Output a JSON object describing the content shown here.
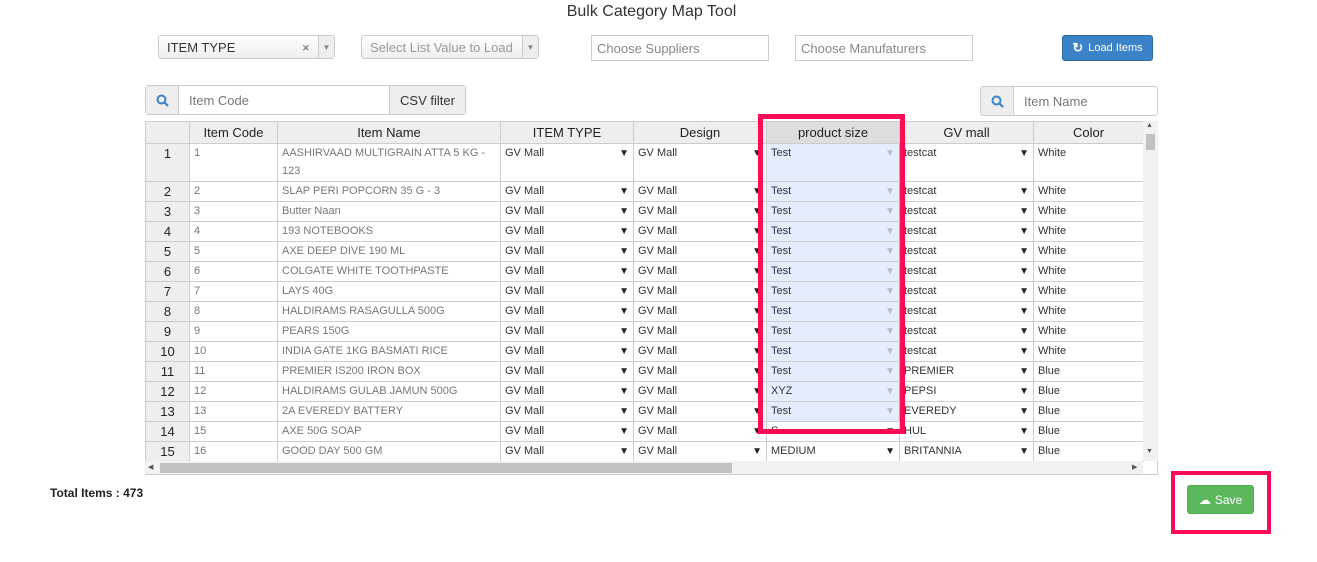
{
  "title": "Bulk Category Map Tool",
  "filters": {
    "item_type_select": "ITEM TYPE",
    "clear": "×",
    "list_value_placeholder": "Select List Value to Load",
    "suppliers_placeholder": "Choose Suppliers",
    "manufacturers_placeholder": "Choose Manufaturers",
    "load_button": "Load Items"
  },
  "search": {
    "item_code_placeholder": "Item Code",
    "csv_filter": "CSV filter",
    "item_name_placeholder": "Item Name"
  },
  "columns": [
    "Item Code",
    "Item Name",
    "ITEM TYPE",
    "Design",
    "product size",
    "GV mall",
    "Color"
  ],
  "rows": [
    {
      "n": "1",
      "code": "1",
      "name": "AASHIRVAAD MULTIGRAIN ATTA 5 KG - 123",
      "type": "GV Mall",
      "design": "GV Mall",
      "size": "Test",
      "mall": "testcat",
      "color": "White"
    },
    {
      "n": "2",
      "code": "2",
      "name": "SLAP PERI POPCORN 35 G - 3",
      "type": "GV Mall",
      "design": "GV Mall",
      "size": "Test",
      "mall": "testcat",
      "color": "White"
    },
    {
      "n": "3",
      "code": "3",
      "name": "Butter Naan",
      "type": "GV Mall",
      "design": "GV Mall",
      "size": "Test",
      "mall": "testcat",
      "color": "White"
    },
    {
      "n": "4",
      "code": "4",
      "name": "193 NOTEBOOKS",
      "type": "GV Mall",
      "design": "GV Mall",
      "size": "Test",
      "mall": "testcat",
      "color": "White"
    },
    {
      "n": "5",
      "code": "5",
      "name": "AXE DEEP DIVE 190 ML",
      "type": "GV Mall",
      "design": "GV Mall",
      "size": "Test",
      "mall": "testcat",
      "color": "White"
    },
    {
      "n": "6",
      "code": "6",
      "name": "COLGATE WHITE TOOTHPASTE",
      "type": "GV Mall",
      "design": "GV Mall",
      "size": "Test",
      "mall": "testcat",
      "color": "White"
    },
    {
      "n": "7",
      "code": "7",
      "name": "LAYS 40G",
      "type": "GV Mall",
      "design": "GV Mall",
      "size": "Test",
      "mall": "testcat",
      "color": "White"
    },
    {
      "n": "8",
      "code": "8",
      "name": "HALDIRAMS RASAGULLA 500G",
      "type": "GV Mall",
      "design": "GV Mall",
      "size": "Test",
      "mall": "testcat",
      "color": "White"
    },
    {
      "n": "9",
      "code": "9",
      "name": "PEARS 150G",
      "type": "GV Mall",
      "design": "GV Mall",
      "size": "Test",
      "mall": "testcat",
      "color": "White"
    },
    {
      "n": "10",
      "code": "10",
      "name": "INDIA GATE 1KG BASMATI RICE",
      "type": "GV Mall",
      "design": "GV Mall",
      "size": "Test",
      "mall": "testcat",
      "color": "White"
    },
    {
      "n": "11",
      "code": "11",
      "name": "PREMIER IS200 IRON BOX",
      "type": "GV Mall",
      "design": "GV Mall",
      "size": "Test",
      "mall": "PREMIER",
      "color": "Blue"
    },
    {
      "n": "12",
      "code": "12",
      "name": "HALDIRAMS GULAB JAMUN 500G",
      "type": "GV Mall",
      "design": "GV Mall",
      "size": "XYZ",
      "mall": "PEPSI",
      "color": "Blue"
    },
    {
      "n": "13",
      "code": "13",
      "name": "2A EVEREDY BATTERY",
      "type": "GV Mall",
      "design": "GV Mall",
      "size": "Test",
      "mall": "EVEREDY",
      "color": "Blue"
    },
    {
      "n": "14",
      "code": "15",
      "name": "AXE 50G SOAP",
      "type": "GV Mall",
      "design": "GV Mall",
      "size": "S",
      "mall": "HUL",
      "color": "Blue"
    },
    {
      "n": "15",
      "code": "16",
      "name": "GOOD DAY 500 GM",
      "type": "GV Mall",
      "design": "GV Mall",
      "size": "MEDIUM",
      "mall": "BRITANNIA",
      "color": "Blue"
    }
  ],
  "footer": {
    "total_items": "Total Items : 473",
    "save": "Save"
  },
  "colors": {
    "primary": "#3a83c9",
    "success": "#5cb85c",
    "highlight": "#ff0a55",
    "selection": "#e3edfc"
  }
}
